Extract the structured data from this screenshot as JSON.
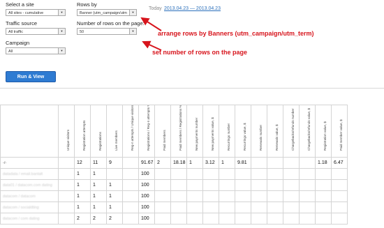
{
  "filters": {
    "site": {
      "label": "Select a site",
      "value": "All sites - cumulative"
    },
    "traffic": {
      "label": "Traffic source",
      "value": "All traffic"
    },
    "campaign": {
      "label": "Campaign",
      "value": "All"
    },
    "rows_by": {
      "label": "Rows by",
      "value": "Banner (utm_campaign/utm"
    },
    "rows_num": {
      "label": "Number of rows on the page:",
      "value": "50"
    }
  },
  "date": {
    "today": "Today",
    "range": "2013.04.23 — 2013.04.23"
  },
  "annotations": {
    "note1": "arrange rows by Banners (utm_campaign/utm_term)",
    "note2": "set number of rows on the page"
  },
  "run_button": "Run & View",
  "table": {
    "columns": [
      "",
      "Unique visitors",
      "Registration attempts",
      "Registrations",
      "Live members",
      "Reg-n attempts / Unique visitors %",
      "Registrations / Reg-n attempts %",
      "Paid members",
      "Paid members / Registrations %",
      "New payments number",
      "New payments value, $",
      "Recurrings number",
      "Recurrings value, $",
      "Renewals number",
      "Renewals value, $",
      "Chargebacks/refunds number",
      "Chargebacks/refunds value, $",
      "Registration value, $",
      "Paid member value, $"
    ],
    "rows": [
      [
        "-/-",
        "",
        "12",
        "11",
        "9",
        "",
        "91.67",
        "2",
        "18.18",
        "1",
        "3.12",
        "1",
        "9.81",
        "",
        "",
        "",
        "",
        "1.18",
        "6.47"
      ],
      [
        "datadata / email.bantalt",
        "",
        "1",
        "1",
        "",
        "",
        "100",
        "",
        "",
        "",
        "",
        "",
        "",
        "",
        "",
        "",
        "",
        "",
        ""
      ],
      [
        "data01 / datacom.com dating",
        "",
        "1",
        "1",
        "1",
        "",
        "100",
        "",
        "",
        "",
        "",
        "",
        "",
        "",
        "",
        "",
        "",
        "",
        ""
      ],
      [
        "datacom / datacom",
        "",
        "1",
        "1",
        "1",
        "",
        "100",
        "",
        "",
        "",
        "",
        "",
        "",
        "",
        "",
        "",
        "",
        "",
        ""
      ],
      [
        "datacom / socialdting",
        "",
        "1",
        "1",
        "1",
        "",
        "100",
        "",
        "",
        "",
        "",
        "",
        "",
        "",
        "",
        "",
        "",
        "",
        ""
      ],
      [
        "datacom / com dating",
        "",
        "2",
        "2",
        "2",
        "",
        "100",
        "",
        "",
        "",
        "",
        "",
        "",
        "",
        "",
        "",
        "",
        "",
        ""
      ]
    ]
  },
  "colors": {
    "accent": "#2e7bd2",
    "annotation": "#d7141c",
    "link": "#2a6fbb"
  }
}
